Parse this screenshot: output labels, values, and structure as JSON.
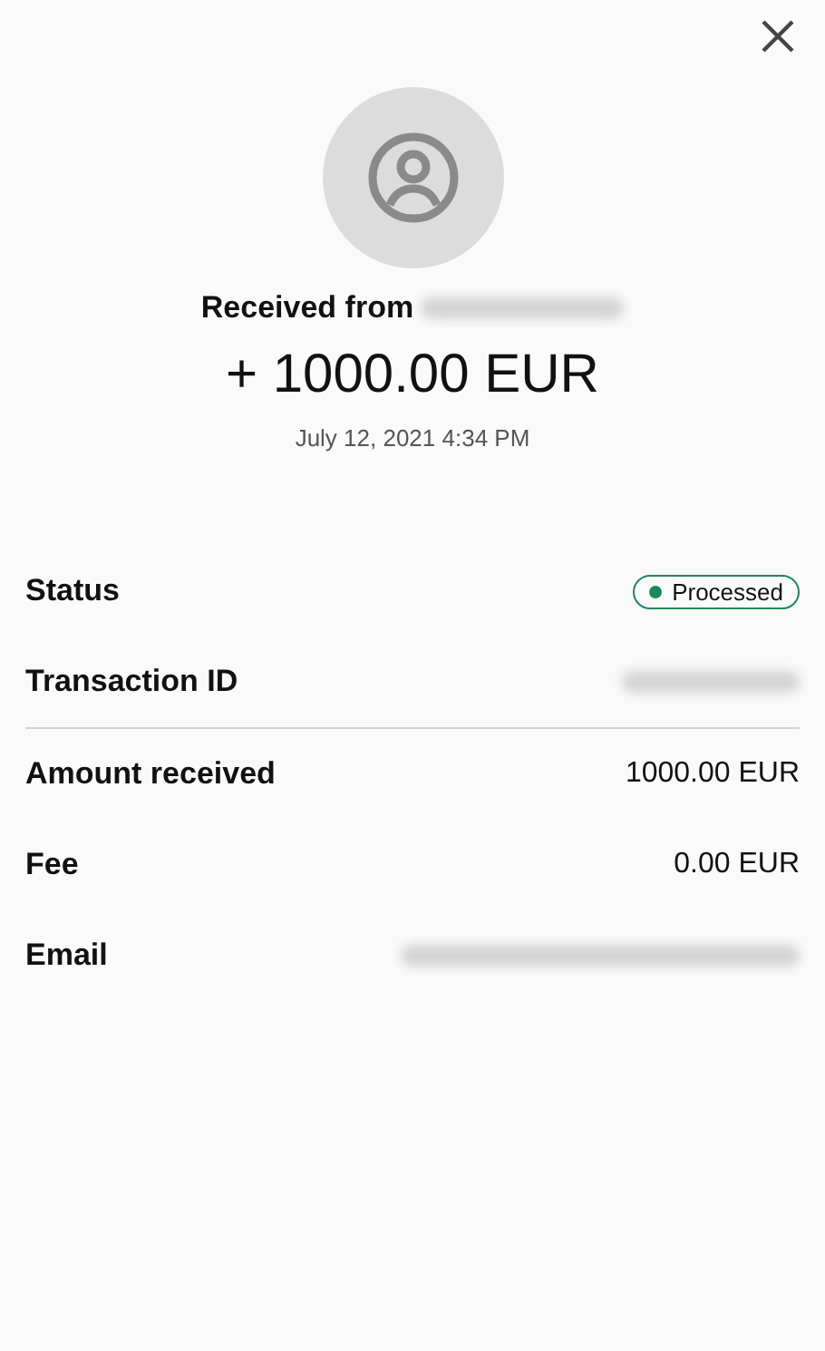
{
  "header": {
    "title": "Received from",
    "sender_redacted": true,
    "amount": "+ 1000.00 EUR",
    "date": "July 12, 2021 4:34 PM"
  },
  "rows": [
    {
      "label": "Status",
      "kind": "status",
      "value": "Processed",
      "color": "#1a8a5a",
      "divider_after": false
    },
    {
      "label": "Transaction ID",
      "kind": "redacted",
      "divider_after": true
    },
    {
      "label": "Amount received",
      "kind": "text",
      "value": "1000.00 EUR",
      "divider_after": false
    },
    {
      "label": "Fee",
      "kind": "text",
      "value": "0.00 EUR",
      "divider_after": false
    },
    {
      "label": "Email",
      "kind": "redacted",
      "divider_after": false
    }
  ]
}
